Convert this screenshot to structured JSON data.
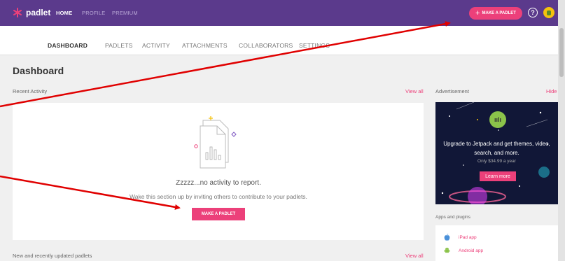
{
  "topbar": {
    "logo_text": "padlet",
    "nav": [
      "HOME",
      "PROFILE",
      "PREMIUM"
    ],
    "make_padlet_label": "MAKE A PADLET",
    "help_icon": "question-circle-icon",
    "avatar_icon": "user-avatar-icon"
  },
  "tabs": [
    "DASHBOARD",
    "PADLETS",
    "ACTIVITY",
    "ATTACHMENTS",
    "COLLABORATORS",
    "SETTINGS"
  ],
  "page_title": "Dashboard",
  "recent_activity": {
    "label": "Recent Activity",
    "view_all": "View all",
    "empty_title": "Zzzzz...no activity to report.",
    "empty_subtitle": "Wake this section up by inviting others to contribute to your padlets.",
    "make_padlet_label": "MAKE A PADLET"
  },
  "advertisement": {
    "label": "Advertisement",
    "hide": "Hide",
    "line1": "Upgrade to Jetpack and get themes, video,",
    "line2": "search, and more.",
    "price": "Only $34.99 a year",
    "button": "Learn more"
  },
  "apps": {
    "label": "Apps and plugins",
    "items": [
      "iPad app",
      "Android app"
    ]
  },
  "recent_padlets": {
    "label": "New and recently updated padlets",
    "view_all": "View all"
  },
  "colors": {
    "topbar": "#5b3a8c",
    "accent": "#ec407a"
  }
}
